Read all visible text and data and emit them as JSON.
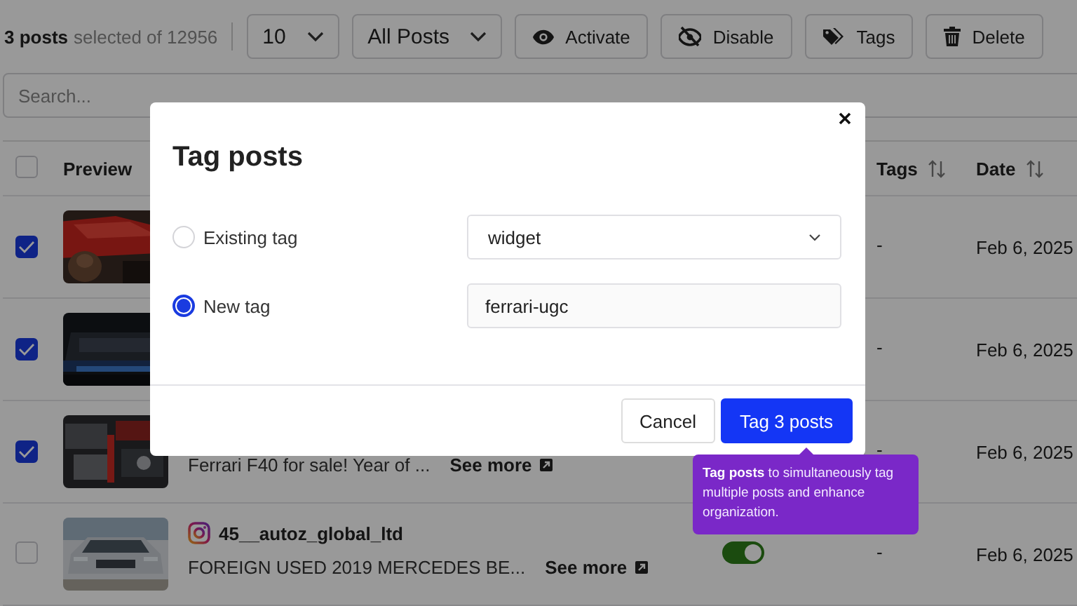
{
  "toolbar": {
    "selection_count": "3 posts",
    "selection_note": "selected of 12956",
    "page_size": "10",
    "filter": "All Posts",
    "actions": [
      {
        "label": "Activate",
        "kind": "eye"
      },
      {
        "label": "Disable",
        "kind": "eye-off"
      },
      {
        "label": "Tags",
        "kind": "tag"
      },
      {
        "label": "Delete",
        "kind": "trash"
      }
    ]
  },
  "search": {
    "placeholder": "Search..."
  },
  "table": {
    "header_checked": false,
    "columns": [
      {
        "label": "Preview",
        "sortable": false
      },
      {
        "label": "Tags",
        "sortable": true
      },
      {
        "label": "Date",
        "sortable": true
      }
    ],
    "rows": [
      {
        "checked": true,
        "tags": "-",
        "date": "Feb 6, 2025"
      },
      {
        "checked": true,
        "tags": "-",
        "date": "Feb 6, 2025"
      },
      {
        "checked": true,
        "caption": "Ferrari F40 for sale! Year of ...",
        "see_more": "See more",
        "tags": "-",
        "date": "Feb 6, 2025"
      },
      {
        "checked": false,
        "account": "45__autoz_global_ltd",
        "caption": "FOREIGN USED 2019 MERCEDES BE...",
        "see_more": "See more",
        "active": true,
        "tags": "-",
        "date": "Feb 6, 2025"
      }
    ]
  },
  "modal": {
    "title": "Tag posts",
    "options": [
      {
        "label": "Existing tag",
        "selected": false,
        "kind": "select",
        "value": "widget"
      },
      {
        "label": "New tag",
        "selected": true,
        "kind": "text",
        "value": "ferrari-ugc"
      }
    ],
    "buttons": [
      {
        "label": "Cancel",
        "kind": "secondary"
      },
      {
        "label": "Tag 3 posts",
        "kind": "primary"
      }
    ]
  },
  "tooltip": {
    "text": "**Tag posts** to simultaneously tag multiple posts and enhance organization."
  }
}
